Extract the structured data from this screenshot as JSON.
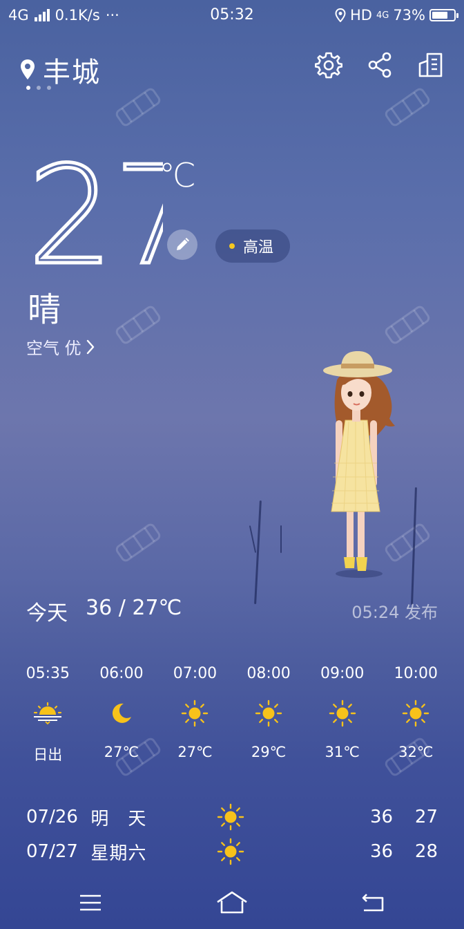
{
  "status_bar": {
    "network": "4G",
    "speed": "0.1K/s",
    "more": "···",
    "time": "05:32",
    "hd": "HD",
    "net2": "4G",
    "battery": "73%",
    "battery_level": 0.73
  },
  "header": {
    "city": "丰城",
    "page_count": 3,
    "active_page": 0
  },
  "current": {
    "temperature": "27",
    "unit": "℃",
    "condition": "晴",
    "air_quality": "空气 优",
    "alert": "高温",
    "alert_color": "#f5c81f"
  },
  "today": {
    "label": "今天",
    "range": "36 / 27℃",
    "published": "05:24 发布"
  },
  "hourly": [
    {
      "time": "05:35",
      "icon": "sunrise-icon",
      "temp": "日出"
    },
    {
      "time": "06:00",
      "icon": "moon-icon",
      "temp": "27℃"
    },
    {
      "time": "07:00",
      "icon": "sun-icon",
      "temp": "27℃"
    },
    {
      "time": "08:00",
      "icon": "sun-icon",
      "temp": "29℃"
    },
    {
      "time": "09:00",
      "icon": "sun-icon",
      "temp": "31℃"
    },
    {
      "time": "10:00",
      "icon": "sun-icon",
      "temp": "32℃"
    }
  ],
  "daily": [
    {
      "date": "07/26",
      "day": "明　天",
      "icon": "sun-icon",
      "high": "36",
      "low": "27"
    },
    {
      "date": "07/27",
      "day": "星期六",
      "icon": "sun-icon",
      "high": "36",
      "low": "28"
    }
  ],
  "colors": {
    "sun": "#f7c21b",
    "background_top": "#4a62a0",
    "background_bottom": "#344694"
  }
}
